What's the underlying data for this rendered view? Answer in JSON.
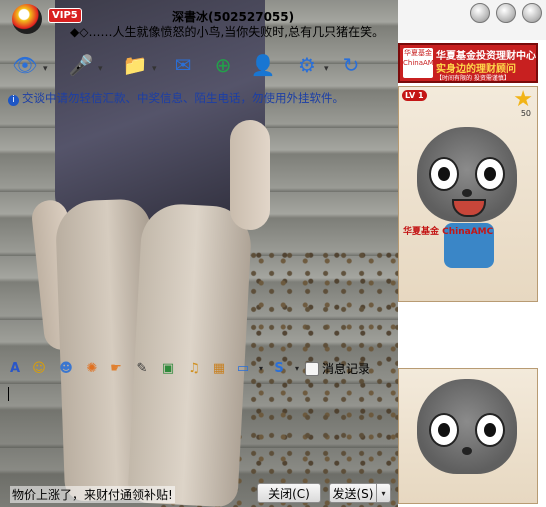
{
  "header": {
    "vip_label": "VIP5",
    "nickname": "深書冰(502527055)",
    "signature": "◆◇……人生就像愤怒的小鸟,当你失败时,总有几只猪在笑。",
    "window_buttons": [
      "minimize",
      "maximize",
      "close"
    ]
  },
  "toolbar": {
    "items": [
      {
        "icon": "webcam-icon",
        "glyph": "👁",
        "color": "#2a6fd8"
      },
      {
        "icon": "microphone-icon",
        "glyph": "🎤",
        "color": "#2a6fd8"
      },
      {
        "icon": "send-file-icon",
        "glyph": "📁",
        "color": "#2a6fd8"
      },
      {
        "icon": "email-icon",
        "glyph": "✉",
        "color": "#2a6fd8"
      },
      {
        "icon": "add-app-icon",
        "glyph": "⊕",
        "color": "#23a04a"
      },
      {
        "icon": "user-info-icon",
        "glyph": "👤",
        "color": "#2a6fd8"
      },
      {
        "icon": "settings-icon",
        "glyph": "⚙",
        "color": "#2a6fd8"
      },
      {
        "icon": "more-icon",
        "glyph": "↻",
        "color": "#2a6fd8"
      }
    ]
  },
  "notice": {
    "text": "交谈中请勿轻信汇款、中奖信息、陌生电话，勿使用外挂软件。"
  },
  "sidebar": {
    "ad_line1": "华夏基金投资理财中心",
    "ad_line2": "实身边的理财顾问",
    "ad_line3": "【时间有限的   投资需谨慎】",
    "ad_logo_text": "华夏基金 ChinaAMC",
    "level_badge": "LV 1",
    "star_value": "50",
    "card2_brand": "华夏基金 ChinaAMC"
  },
  "composer": {
    "message_log_label": "消息记录",
    "tools": [
      {
        "icon": "font-icon",
        "glyph": "A",
        "color": "#2a56c8"
      },
      {
        "icon": "smiley-icon",
        "glyph": "☺",
        "color": "#e0a000"
      },
      {
        "icon": "magic-face-icon",
        "glyph": "☻",
        "color": "#3a76d0"
      },
      {
        "icon": "shake-window-icon",
        "glyph": "✺",
        "color": "#e07020"
      },
      {
        "icon": "hand-icon",
        "glyph": "☛",
        "color": "#e08030"
      },
      {
        "icon": "scribble-icon",
        "glyph": "✎",
        "color": "#3a3a3a"
      },
      {
        "icon": "picture-icon",
        "glyph": "▣",
        "color": "#2e8a3a"
      },
      {
        "icon": "music-icon",
        "glyph": "♫",
        "color": "#d09020"
      },
      {
        "icon": "gift-icon",
        "glyph": "▦",
        "color": "#c88020"
      },
      {
        "icon": "screen-capture-icon",
        "glyph": "▭",
        "color": "#2a6fd8"
      },
      {
        "icon": "soso-icon",
        "glyph": "S",
        "color": "#2a6fd8"
      }
    ]
  },
  "bottom": {
    "ad_text": "物价上涨了，来财付通领补贴!",
    "close_label": "关闭(C)",
    "send_label": "发送(S)"
  }
}
